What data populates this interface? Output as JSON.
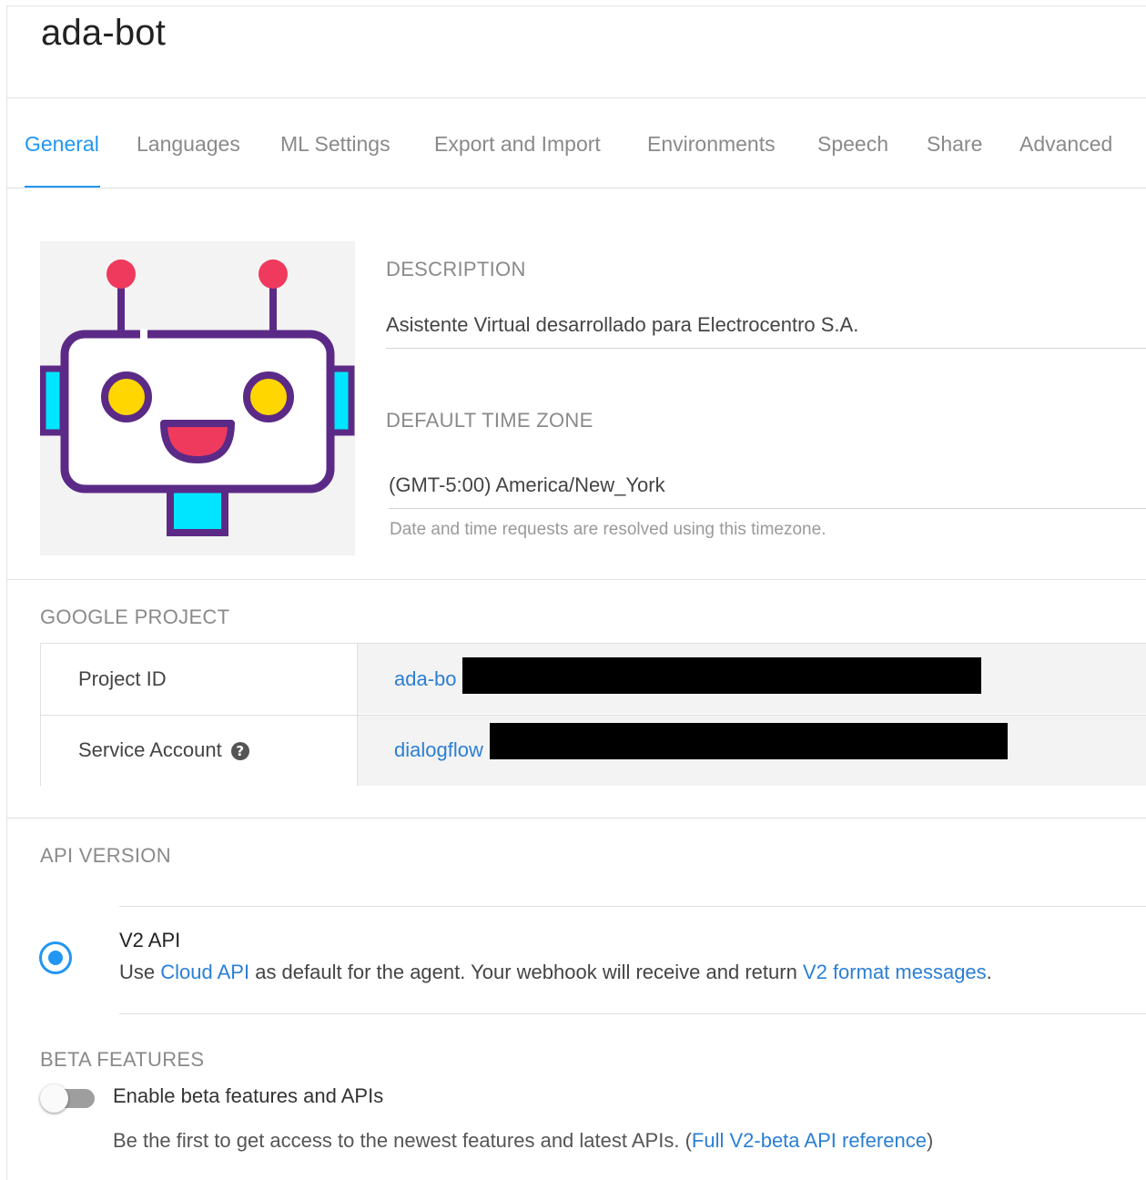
{
  "agent": {
    "name": "ada-bot"
  },
  "tabs": [
    {
      "label": "General",
      "active": true
    },
    {
      "label": "Languages",
      "active": false
    },
    {
      "label": "ML Settings",
      "active": false
    },
    {
      "label": "Export and Import",
      "active": false
    },
    {
      "label": "Environments",
      "active": false
    },
    {
      "label": "Speech",
      "active": false
    },
    {
      "label": "Share",
      "active": false
    },
    {
      "label": "Advanced",
      "active": false
    }
  ],
  "general": {
    "description_label": "DESCRIPTION",
    "description_value": "Asistente Virtual desarrollado para Electrocentro S.A.",
    "timezone_label": "DEFAULT TIME ZONE",
    "timezone_value": "(GMT-5:00) America/New_York",
    "timezone_hint": "Date and time requests are resolved using this timezone."
  },
  "google_project": {
    "label": "GOOGLE PROJECT",
    "rows": [
      {
        "label": "Project ID",
        "value": "ada-bo"
      },
      {
        "label": "Service Account",
        "value": "dialogflow"
      }
    ]
  },
  "api_version": {
    "label": "API VERSION",
    "option_title": "V2 API",
    "desc_prefix": "Use ",
    "desc_link1": "Cloud API",
    "desc_middle": " as default for the agent. Your webhook will receive and return ",
    "desc_link2": "V2 format messages",
    "desc_suffix": ".",
    "selected": true
  },
  "beta": {
    "label": "BETA FEATURES",
    "toggle_label": "Enable beta features and APIs",
    "toggle_on": false,
    "desc_prefix": "Be the first to get access to the newest features and latest APIs. (",
    "desc_link": "Full V2-beta API reference",
    "desc_suffix": ")"
  },
  "icons": {
    "avatar": "robot-avatar-icon",
    "help": "help-circle-icon"
  },
  "colors": {
    "accent": "#2196f3",
    "link": "#2b7fd4",
    "robot_outline": "#5b2a86",
    "robot_antenna": "#ef3a5d",
    "robot_eyes": "#ffd600",
    "robot_ears": "#00e5ff"
  }
}
